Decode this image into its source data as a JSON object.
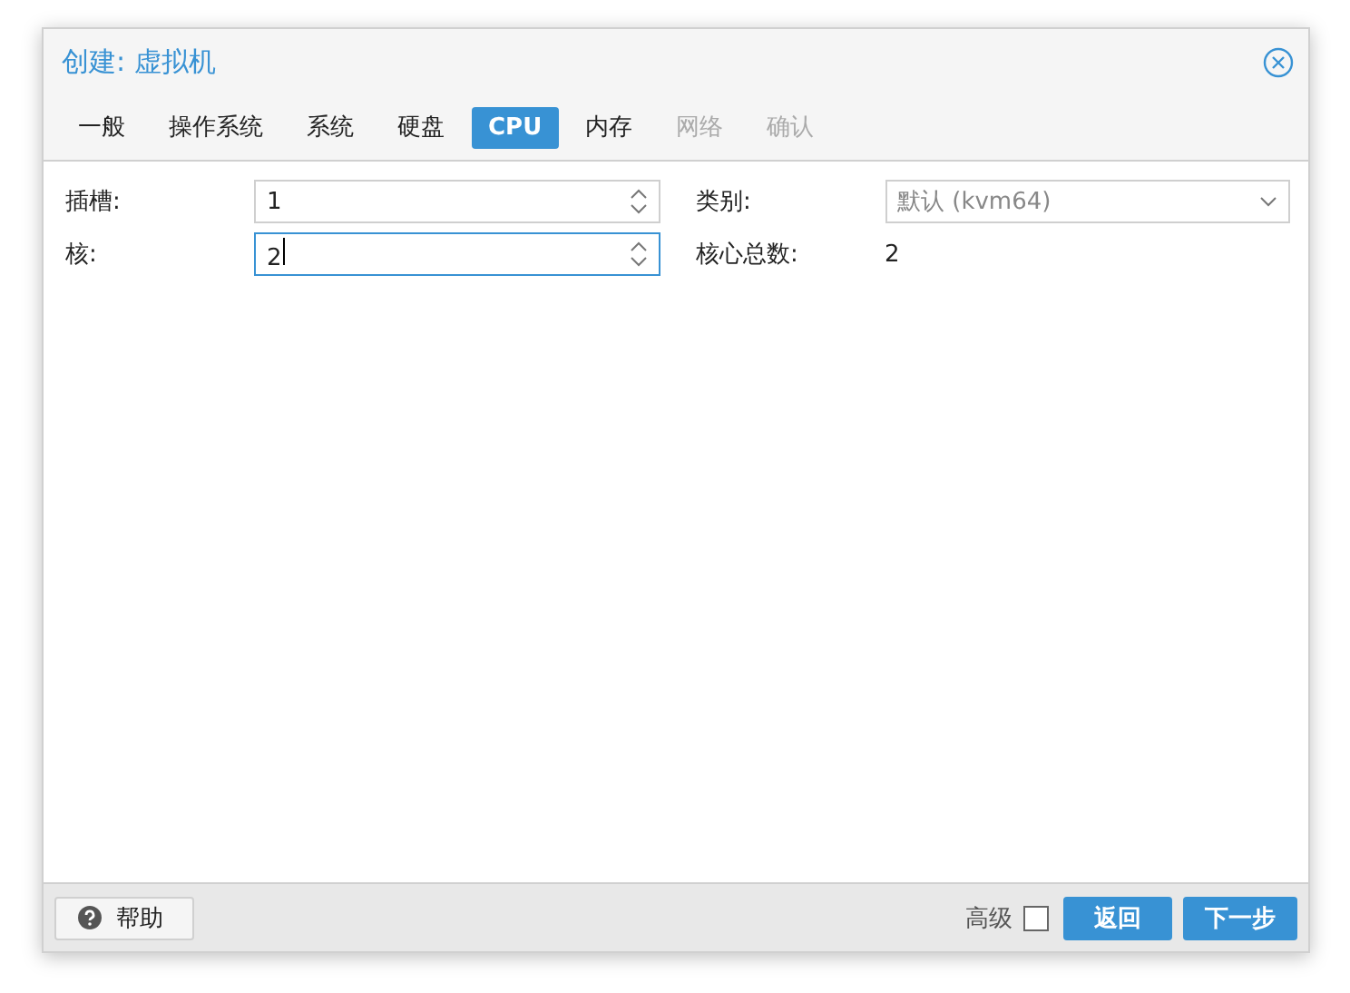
{
  "window": {
    "title": "创建: 虚拟机"
  },
  "tabs": [
    {
      "label": "一般",
      "selected": false,
      "disabled": false
    },
    {
      "label": "操作系统",
      "selected": false,
      "disabled": false
    },
    {
      "label": "系统",
      "selected": false,
      "disabled": false
    },
    {
      "label": "硬盘",
      "selected": false,
      "disabled": false
    },
    {
      "label": "CPU",
      "selected": true,
      "disabled": false
    },
    {
      "label": "内存",
      "selected": false,
      "disabled": false
    },
    {
      "label": "网络",
      "selected": false,
      "disabled": true
    },
    {
      "label": "确认",
      "selected": false,
      "disabled": true
    }
  ],
  "left_fields": [
    {
      "label": "插槽:",
      "value": "1",
      "focused": false
    },
    {
      "label": "核:",
      "value": "2",
      "focused": true
    }
  ],
  "right_fields": [
    {
      "kind": "select",
      "label": "类别:",
      "placeholder": "默认 (kvm64)"
    },
    {
      "kind": "text",
      "label": "核心总数:",
      "value": "2"
    }
  ],
  "footer": {
    "help": "帮助",
    "advanced": {
      "label": "高级",
      "checked": false
    },
    "buttons": [
      "返回",
      "下一步"
    ]
  }
}
